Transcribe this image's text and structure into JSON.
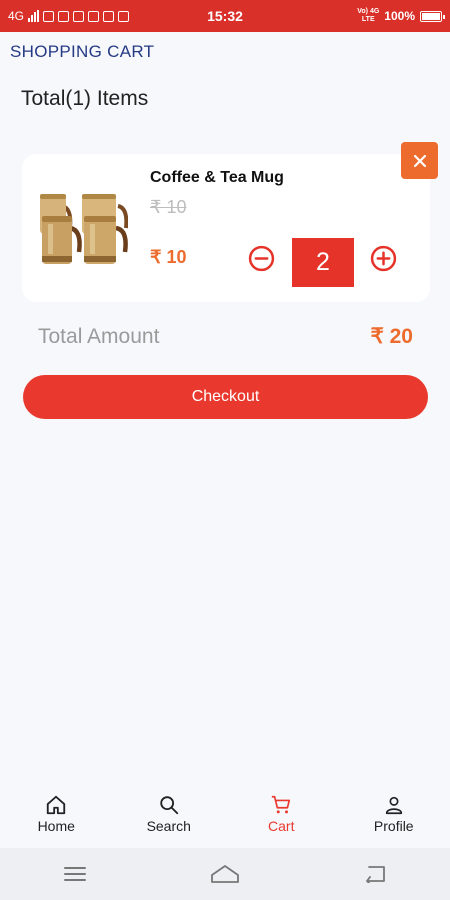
{
  "status_bar": {
    "network": "4G",
    "time": "15:32",
    "volte": "Vo) 4G",
    "lte": "LTE",
    "battery_text": "100%"
  },
  "header": {
    "title": "SHOPPING CART"
  },
  "cart": {
    "count_text": "Total(1) Items",
    "items": [
      {
        "name": "Coffee & Tea Mug",
        "original_price": "₹ 10",
        "price": "₹ 10",
        "quantity": "2",
        "remove_icon": "close-icon",
        "image": "coffee-tea-mug-set"
      }
    ],
    "total_label": "Total Amount",
    "total_value": "₹ 20",
    "checkout_label": "Checkout"
  },
  "bottom_nav": {
    "items": [
      {
        "label": "Home",
        "icon": "home-icon"
      },
      {
        "label": "Search",
        "icon": "search-icon"
      },
      {
        "label": "Cart",
        "icon": "cart-icon",
        "active": true
      },
      {
        "label": "Profile",
        "icon": "profile-icon"
      }
    ]
  },
  "colors": {
    "status_bar": "#d9302a",
    "accent": "#e9392e",
    "price": "#ec6b2d",
    "title": "#253a84",
    "background": "#f7f8fc"
  }
}
